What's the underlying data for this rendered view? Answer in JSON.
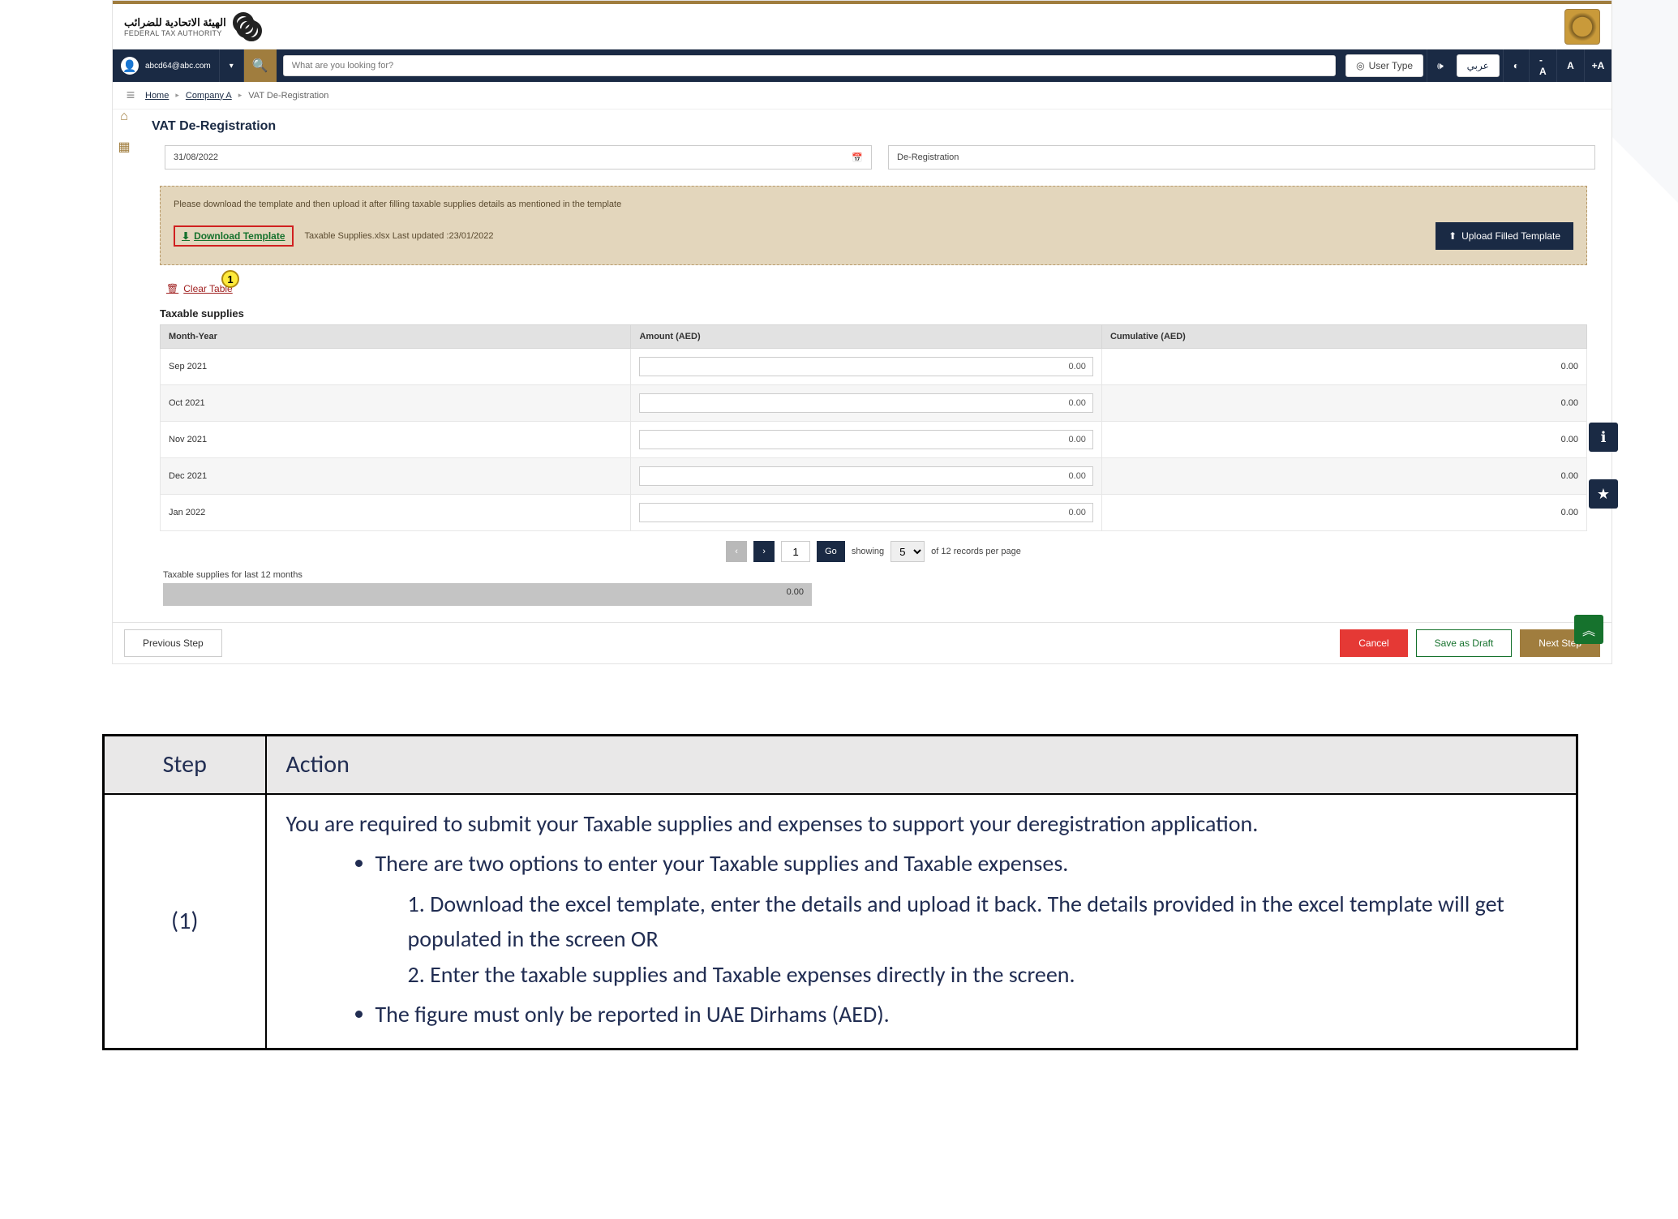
{
  "header": {
    "org_ar": "الهيئة الاتحادية للضرائب",
    "org_en": "FEDERAL TAX AUTHORITY"
  },
  "topbar": {
    "user_email": "abcd64@abc.com",
    "search_placeholder": "What are you looking for?",
    "user_type": "User Type",
    "lang_ar": "عربي",
    "text_dec": "-A",
    "text_norm": "A",
    "text_inc": "+A"
  },
  "breadcrumb": {
    "home": "Home",
    "company": "Company A",
    "current": "VAT De-Registration"
  },
  "page_title": "VAT De-Registration",
  "fields": {
    "date": "31/08/2022",
    "reason": "De-Registration"
  },
  "banner": {
    "note": "Please download the template and then upload it after filling taxable supplies details as mentioned in the template",
    "download": "Download Template",
    "fileinfo": "Taxable Supplies.xlsx Last updated :23/01/2022",
    "upload": "Upload Filled Template"
  },
  "callout1": "1",
  "clear_table": "Clear Table",
  "section_title": "Taxable supplies",
  "columns": {
    "c1": "Month-Year",
    "c2": "Amount (AED)",
    "c3": "Cumulative (AED)"
  },
  "rows": [
    {
      "m": "Sep 2021",
      "a": "0.00",
      "c": "0.00"
    },
    {
      "m": "Oct 2021",
      "a": "0.00",
      "c": "0.00"
    },
    {
      "m": "Nov 2021",
      "a": "0.00",
      "c": "0.00"
    },
    {
      "m": "Dec 2021",
      "a": "0.00",
      "c": "0.00"
    },
    {
      "m": "Jan 2022",
      "a": "0.00",
      "c": "0.00"
    }
  ],
  "pager": {
    "page": "1",
    "go": "Go",
    "showing": "showing",
    "per": "5",
    "tail": "of 12 records per page"
  },
  "total_label": "Taxable supplies for last 12 months",
  "total_value": "0.00",
  "foot": {
    "prev": "Previous Step",
    "cancel": "Cancel",
    "draft": "Save as Draft",
    "next": "Next Step"
  },
  "instr": {
    "h1": "Step",
    "h2": "Action",
    "step": "(1)",
    "p1": "You are required to submit your Taxable supplies and expenses to support your deregistration application.",
    "b1": "There are two options to enter your Taxable supplies and Taxable expenses.",
    "n1": "1. Download the excel template, enter the details and upload it back. The details provided in the excel template will get populated in the screen OR",
    "n2": "2. Enter the taxable supplies and Taxable expenses directly in the screen.",
    "b2": "The figure must only be reported in UAE Dirhams (AED)."
  }
}
